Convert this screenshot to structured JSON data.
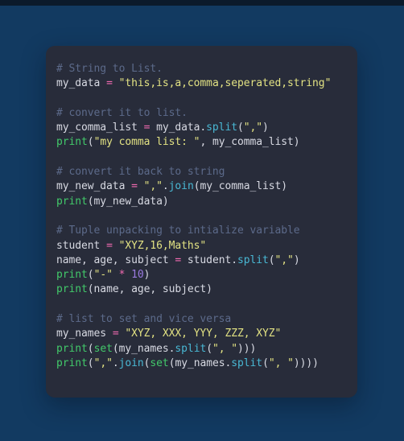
{
  "theme": {
    "backdrop_color": "#123a61",
    "card_background": "#282c3a",
    "comment_color": "#5c6a8a",
    "string_color": "#e2e283",
    "builtin_color": "#42c96a",
    "method_color": "#49b8d4",
    "operator_color": "#f06ab0",
    "number_color": "#9a7ae0",
    "identifier_color": "#d8dae3"
  },
  "code": {
    "language": "python",
    "lines": [
      {
        "type": "code",
        "tokens": [
          {
            "t": "# String to List.",
            "c": "com"
          }
        ]
      },
      {
        "type": "code",
        "tokens": [
          {
            "t": "my_data ",
            "c": "id"
          },
          {
            "t": "=",
            "c": "op"
          },
          {
            "t": " ",
            "c": "pun"
          },
          {
            "t": "\"this,is,a,comma,seperated,string\"",
            "c": "str"
          }
        ]
      },
      {
        "type": "blank",
        "tokens": []
      },
      {
        "type": "code",
        "tokens": [
          {
            "t": "# convert it to list.",
            "c": "com"
          }
        ]
      },
      {
        "type": "code",
        "tokens": [
          {
            "t": "my_comma_list ",
            "c": "id"
          },
          {
            "t": "=",
            "c": "op"
          },
          {
            "t": " my_data.",
            "c": "id"
          },
          {
            "t": "split",
            "c": "meth"
          },
          {
            "t": "(",
            "c": "pun"
          },
          {
            "t": "\",\"",
            "c": "str"
          },
          {
            "t": ")",
            "c": "pun"
          }
        ]
      },
      {
        "type": "code",
        "tokens": [
          {
            "t": "print",
            "c": "fn"
          },
          {
            "t": "(",
            "c": "pun"
          },
          {
            "t": "\"my comma list: \"",
            "c": "str"
          },
          {
            "t": ", my_comma_list)",
            "c": "id"
          }
        ]
      },
      {
        "type": "blank",
        "tokens": []
      },
      {
        "type": "code",
        "tokens": [
          {
            "t": "# convert it back to string",
            "c": "com"
          }
        ]
      },
      {
        "type": "code",
        "tokens": [
          {
            "t": "my_new_data ",
            "c": "id"
          },
          {
            "t": "=",
            "c": "op"
          },
          {
            "t": " ",
            "c": "pun"
          },
          {
            "t": "\",\"",
            "c": "str"
          },
          {
            "t": ".",
            "c": "pun"
          },
          {
            "t": "join",
            "c": "meth"
          },
          {
            "t": "(my_comma_list)",
            "c": "id"
          }
        ]
      },
      {
        "type": "code",
        "tokens": [
          {
            "t": "print",
            "c": "fn"
          },
          {
            "t": "(my_new_data)",
            "c": "id"
          }
        ]
      },
      {
        "type": "blank",
        "tokens": []
      },
      {
        "type": "code",
        "tokens": [
          {
            "t": "# Tuple unpacking to intialize variable",
            "c": "com"
          }
        ]
      },
      {
        "type": "code",
        "tokens": [
          {
            "t": "student ",
            "c": "id"
          },
          {
            "t": "=",
            "c": "op"
          },
          {
            "t": " ",
            "c": "pun"
          },
          {
            "t": "\"XYZ,16,Maths\"",
            "c": "str"
          }
        ]
      },
      {
        "type": "code",
        "tokens": [
          {
            "t": "name, age, subject ",
            "c": "id"
          },
          {
            "t": "=",
            "c": "op"
          },
          {
            "t": " student.",
            "c": "id"
          },
          {
            "t": "split",
            "c": "meth"
          },
          {
            "t": "(",
            "c": "pun"
          },
          {
            "t": "\",\"",
            "c": "str"
          },
          {
            "t": ")",
            "c": "pun"
          }
        ]
      },
      {
        "type": "code",
        "tokens": [
          {
            "t": "print",
            "c": "fn"
          },
          {
            "t": "(",
            "c": "pun"
          },
          {
            "t": "\"-\"",
            "c": "str"
          },
          {
            "t": " ",
            "c": "pun"
          },
          {
            "t": "*",
            "c": "op"
          },
          {
            "t": " ",
            "c": "pun"
          },
          {
            "t": "10",
            "c": "num"
          },
          {
            "t": ")",
            "c": "pun"
          }
        ]
      },
      {
        "type": "code",
        "tokens": [
          {
            "t": "print",
            "c": "fn"
          },
          {
            "t": "(name, age, subject)",
            "c": "id"
          }
        ]
      },
      {
        "type": "blank",
        "tokens": []
      },
      {
        "type": "code",
        "tokens": [
          {
            "t": "# list to set and vice versa",
            "c": "com"
          }
        ]
      },
      {
        "type": "code",
        "tokens": [
          {
            "t": "my_names ",
            "c": "id"
          },
          {
            "t": "=",
            "c": "op"
          },
          {
            "t": " ",
            "c": "pun"
          },
          {
            "t": "\"XYZ, XXX, YYY, ZZZ, XYZ\"",
            "c": "str"
          }
        ]
      },
      {
        "type": "code",
        "tokens": [
          {
            "t": "print",
            "c": "fn"
          },
          {
            "t": "(",
            "c": "pun"
          },
          {
            "t": "set",
            "c": "fn"
          },
          {
            "t": "(my_names.",
            "c": "id"
          },
          {
            "t": "split",
            "c": "meth"
          },
          {
            "t": "(",
            "c": "pun"
          },
          {
            "t": "\", \"",
            "c": "str"
          },
          {
            "t": ")))",
            "c": "pun"
          }
        ]
      },
      {
        "type": "code",
        "tokens": [
          {
            "t": "print",
            "c": "fn"
          },
          {
            "t": "(",
            "c": "pun"
          },
          {
            "t": "\",\"",
            "c": "str"
          },
          {
            "t": ".",
            "c": "pun"
          },
          {
            "t": "join",
            "c": "meth"
          },
          {
            "t": "(",
            "c": "pun"
          },
          {
            "t": "set",
            "c": "fn"
          },
          {
            "t": "(my_names.",
            "c": "id"
          },
          {
            "t": "split",
            "c": "meth"
          },
          {
            "t": "(",
            "c": "pun"
          },
          {
            "t": "\", \"",
            "c": "str"
          },
          {
            "t": "))))",
            "c": "pun"
          }
        ]
      }
    ]
  }
}
